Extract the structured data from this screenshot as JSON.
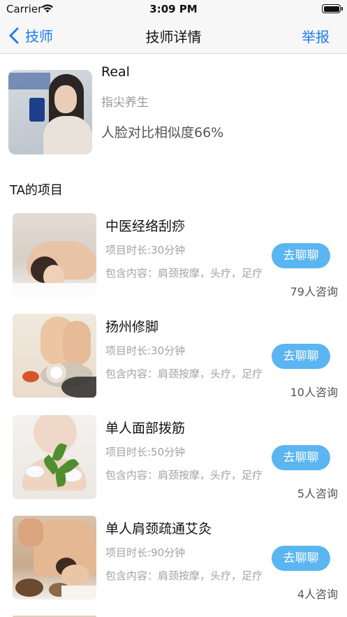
{
  "status_bar": {
    "carrier": "Carrier",
    "time": "3:09 PM"
  },
  "nav": {
    "back_label": "技师",
    "title": "技师详情",
    "report_label": "举报"
  },
  "profile": {
    "name": "Real",
    "shop": "指尖养生",
    "similarity": "人脸对比相似度66%"
  },
  "section_title": "TA的项目",
  "projects": [
    {
      "name": "中医经络刮痧",
      "duration": "项目时长:30分钟",
      "content": "包含内容：肩颈按摩，头疗，足疗",
      "chat_label": "去聊聊",
      "consult": "79人咨询"
    },
    {
      "name": "扬州修脚",
      "duration": "项目时长:30分钟",
      "content": "包含内容：肩颈按摩，头疗，足疗",
      "chat_label": "去聊聊",
      "consult": "10人咨询"
    },
    {
      "name": "单人面部拨筋",
      "duration": "项目时长:50分钟",
      "content": "包含内容：肩颈按摩，头疗，足疗",
      "chat_label": "去聊聊",
      "consult": "5人咨询"
    },
    {
      "name": "单人肩颈疏通艾灸",
      "duration": "项目时长:90分钟",
      "content": "包含内容：肩颈按摩，头疗，足疗",
      "chat_label": "去聊聊",
      "consult": "4人咨询"
    }
  ],
  "colors": {
    "accent": "#1b7cf0",
    "chat_button": "#5ab5f0",
    "muted_text": "#a3a3a3"
  }
}
